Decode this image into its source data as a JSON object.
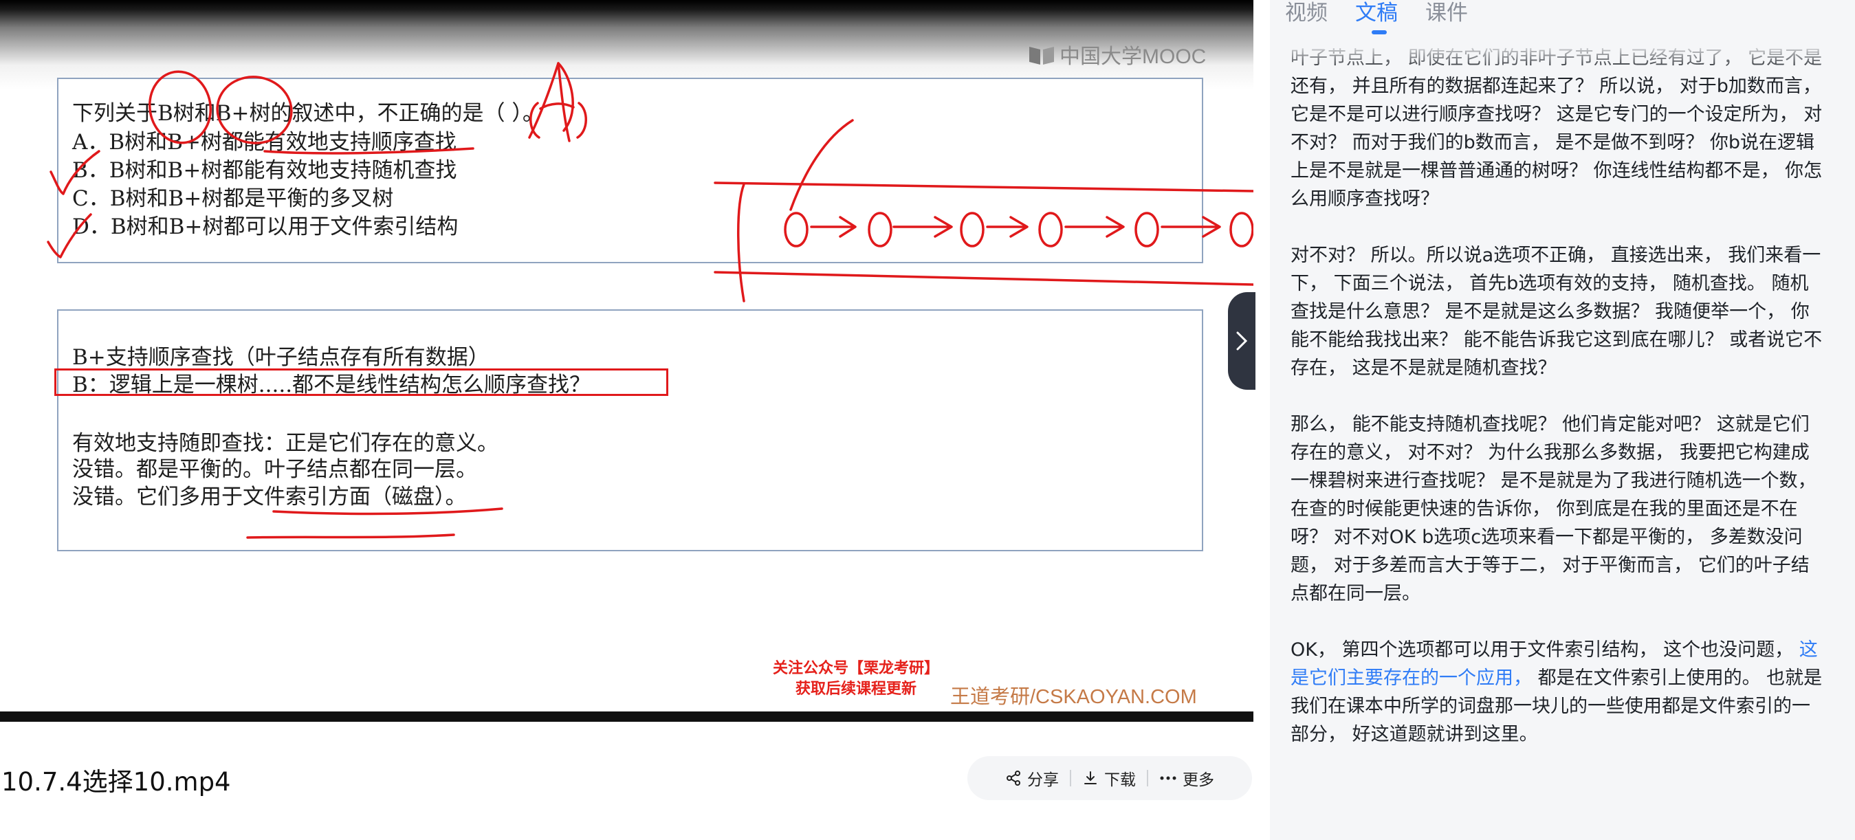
{
  "video": {
    "logo_text": "中国大学MOOC",
    "question": {
      "stem": "下列关于B树和B+树的叙述中，不正确的是（    ）。",
      "options": [
        "A．B树和B+树都能有效地支持顺序查找",
        "B．B树和B+树都能有效地支持随机查找",
        "C．B树和B+树都是平衡的多叉树",
        "D．B树和B+树都可以用于文件索引结构"
      ]
    },
    "answer": {
      "lines": [
        "B+支持顺序查找（叶子结点存有所有数据）",
        "B：逻辑上是一棵树.....都不是线性结构怎么顺序查找？",
        "有效地支持随即查找：正是它们存在的意义。",
        "没错。都是平衡的。叶子结点都在同一层。",
        "没错。它们多用于文件索引方面（磁盘）。"
      ]
    },
    "promo_line1": "关注公众号【栗龙考研】",
    "promo_line2": "获取后续课程更新",
    "watermark": "王道考研/CSKAOYAN.COM",
    "handwritten_answer": "A"
  },
  "file_title": "10.7.4选择10.mp4",
  "actions": {
    "share": "分享",
    "download": "下载",
    "more": "更多"
  },
  "panel": {
    "tabs": [
      "视频",
      "文稿",
      "课件"
    ],
    "active_tab": "文稿",
    "accent_color": "#2f7cf6",
    "paragraphs": [
      "叶子节点上， 即使在它们的非叶子节点上已经有过了， 它是不是还有， 并且所有的数据都连起来了？ 所以说， 对于b加数而言， 它是不是可以进行顺序查找呀？ 这是它专门的一个设定所为， 对不对？ 而对于我们的b数而言， 是不是做不到呀？ 你b说在逻辑上是不是就是一棵普普通通的树呀？ 你连线性结构都不是， 你怎么用顺序查找呀？",
      "对不对？ 所以。所以说a选项不正确， 直接选出来， 我们来看一下， 下面三个说法， 首先b选项有效的支持， 随机查找。 随机查找是什么意思？ 是不是就是这么多数据？ 我随便举一个， 你能不能给我找出来？ 能不能告诉我它这到底在哪儿？ 或者说它不存在， 这是不是就是随机查找？",
      "那么， 能不能支持随机查找呢？ 他们肯定能对吧？ 这就是它们存在的意义， 对不对？ 为什么我那么多数据， 我要把它构建成一棵碧树来进行查找呢？ 是不是就是为了我进行随机选一个数， 在查的时候能更快速的告诉你， 你到底是在我的里面还是不在呀？ 对不对OK b选项c选项来看一下都是平衡的， 多差数没问题， 对于多差而言大于等于二， 对于平衡而言， 它们的叶子结点都在同一层。"
    ],
    "last_paragraph": {
      "before": "OK， 第四个选项都可以用于文件索引结构， 这个也没问题，",
      "highlight": " 这是它们主要存在的一个应用，",
      "after": " 都是在文件索引上使用的。 也就是我们在课本中所学的词盘那一块儿的一些使用都是文件索引的一部分， 好这道题就讲到这里。"
    }
  }
}
